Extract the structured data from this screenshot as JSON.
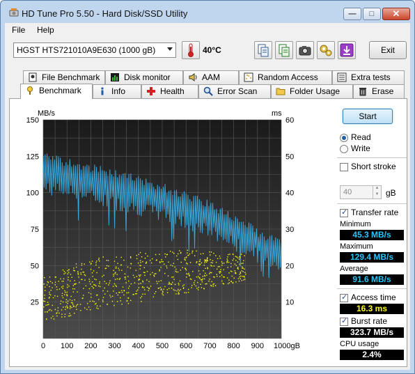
{
  "window": {
    "title": "HD Tune Pro 5.50 - Hard Disk/SSD Utility",
    "controls": {
      "minimize": "—",
      "maximize": "□",
      "close": "✕"
    }
  },
  "menu": [
    {
      "label": "File"
    },
    {
      "label": "Help"
    }
  ],
  "toolbar": {
    "drive": "HGST HTS721010A9E630 (1000 gB)",
    "temperature": "40°C",
    "exit_label": "Exit",
    "tools": [
      {
        "icon": "copy-info-icon"
      },
      {
        "icon": "copy-text-icon"
      },
      {
        "icon": "screenshot-camera-icon"
      },
      {
        "icon": "options-icon"
      },
      {
        "icon": "save-download-icon"
      }
    ]
  },
  "tabs_top": [
    {
      "label": "File Benchmark",
      "icon": "file-benchmark-icon"
    },
    {
      "label": "Disk monitor",
      "icon": "disk-monitor-icon"
    },
    {
      "label": "AAM",
      "icon": "speaker-icon"
    },
    {
      "label": "Random Access",
      "icon": "random-access-icon"
    },
    {
      "label": "Extra tests",
      "icon": "extra-tests-icon"
    }
  ],
  "tabs_bottom": [
    {
      "label": "Benchmark",
      "icon": "benchmark-icon",
      "active": true
    },
    {
      "label": "Info",
      "icon": "info-icon"
    },
    {
      "label": "Health",
      "icon": "health-cross-icon"
    },
    {
      "label": "Error Scan",
      "icon": "magnifier-icon"
    },
    {
      "label": "Folder Usage",
      "icon": "folder-icon"
    },
    {
      "label": "Erase",
      "icon": "trash-icon"
    }
  ],
  "side": {
    "start_label": "Start",
    "read_label": "Read",
    "write_label": "Write",
    "mode": "Read",
    "short_stroke_label": "Short stroke",
    "short_stroke_checked": false,
    "short_stroke_value": "40",
    "short_stroke_unit": "gB",
    "transfer_rate_label": "Transfer rate",
    "transfer_rate_checked": true,
    "minimum_label": "Minimum",
    "minimum_value": "45.3 MB/s",
    "maximum_label": "Maximum",
    "maximum_value": "129.4 MB/s",
    "average_label": "Average",
    "average_value": "91.6 MB/s",
    "access_time_label": "Access time",
    "access_time_checked": true,
    "access_time_value": "16.3 ms",
    "burst_rate_label": "Burst rate",
    "burst_rate_checked": true,
    "burst_rate_value": "323.7 MB/s",
    "cpu_usage_label": "CPU usage",
    "cpu_usage_value": "2.4%"
  },
  "chart_data": {
    "type": "line",
    "left_unit": "MB/s",
    "right_unit": "ms",
    "x_unit": "gB",
    "xlim": [
      0,
      1000
    ],
    "ylim_left": [
      0,
      150
    ],
    "ylim_right": [
      0,
      60
    ],
    "x_ticks": [
      0,
      100,
      200,
      300,
      400,
      500,
      600,
      700,
      800,
      900,
      1000
    ],
    "x_tick_labels": [
      "0",
      "100",
      "200",
      "300",
      "400",
      "500",
      "600",
      "700",
      "800",
      "900",
      "1000gB"
    ],
    "y_ticks_left": [
      "25",
      "50",
      "75",
      "100",
      "125",
      "150"
    ],
    "y_ticks_right": [
      "10",
      "20",
      "30",
      "40",
      "50",
      "60"
    ],
    "grid": true,
    "series": [
      {
        "name": "Transfer rate",
        "axis": "left",
        "color": "#3aa6d8",
        "x": [
          0,
          100,
          200,
          300,
          400,
          500,
          600,
          700,
          800,
          900,
          1000
        ],
        "upper": [
          128,
          124,
          120,
          116,
          112,
          107,
          101,
          95,
          86,
          76,
          68
        ],
        "lower": [
          98,
          96,
          92,
          88,
          84,
          80,
          74,
          68,
          60,
          52,
          45
        ]
      },
      {
        "name": "Access time",
        "axis": "right",
        "color": "#ffff00",
        "x": [
          0,
          100,
          200,
          300,
          400,
          500,
          600,
          700,
          800,
          900
        ],
        "center": [
          11,
          13,
          15,
          16,
          17,
          18,
          18.5,
          19,
          19.5,
          20
        ],
        "spread": [
          6,
          7,
          7,
          7,
          7,
          6,
          6,
          5,
          4,
          3
        ]
      }
    ]
  }
}
